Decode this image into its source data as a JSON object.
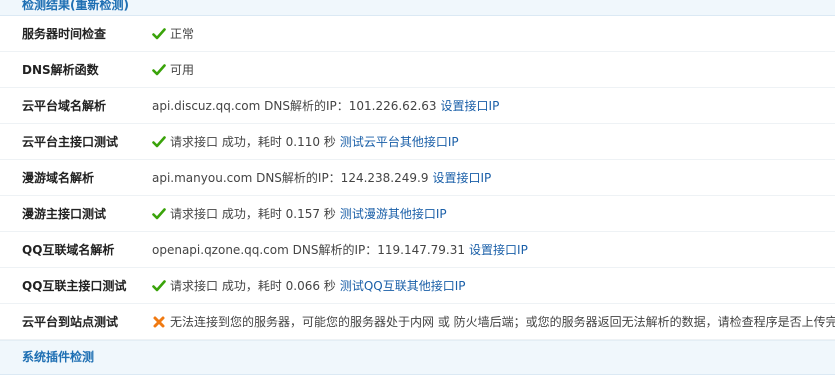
{
  "header": {
    "title": "检测结果(重新检测)"
  },
  "rows": [
    {
      "label": "服务器时间检查",
      "status": "ok",
      "text": "正常"
    },
    {
      "label": "DNS解析函数",
      "status": "ok",
      "text": "可用"
    },
    {
      "label": "云平台域名解析",
      "text": "api.discuz.qq.com DNS解析的IP：101.226.62.63",
      "link": "设置接口IP"
    },
    {
      "label": "云平台主接口测试",
      "status": "ok",
      "text": "请求接口 成功，耗时 0.110 秒",
      "link": "测试云平台其他接口IP"
    },
    {
      "label": "漫游域名解析",
      "text": "api.manyou.com DNS解析的IP：124.238.249.9",
      "link": "设置接口IP"
    },
    {
      "label": "漫游主接口测试",
      "status": "ok",
      "text": "请求接口 成功，耗时 0.157 秒",
      "link": "测试漫游其他接口IP"
    },
    {
      "label": "QQ互联域名解析",
      "text": "openapi.qzone.qq.com DNS解析的IP：119.147.79.31",
      "link": "设置接口IP"
    },
    {
      "label": "QQ互联主接口测试",
      "status": "ok",
      "text": "请求接口 成功，耗时 0.066 秒",
      "link": "测试QQ互联其他接口IP"
    },
    {
      "label": "云平台到站点测试",
      "status": "error",
      "text": "无法连接到您的服务器，可能您的服务器处于内网 或 防火墙后端；或您的服务器返回无法解析的数据，请检查程序是否上传完整"
    }
  ],
  "footer": {
    "title": "系统插件检测"
  },
  "colors": {
    "ok": "#3aa30a",
    "error": "#f07a12",
    "link": "#1a5fa8",
    "header_text": "#1e6fb3"
  }
}
